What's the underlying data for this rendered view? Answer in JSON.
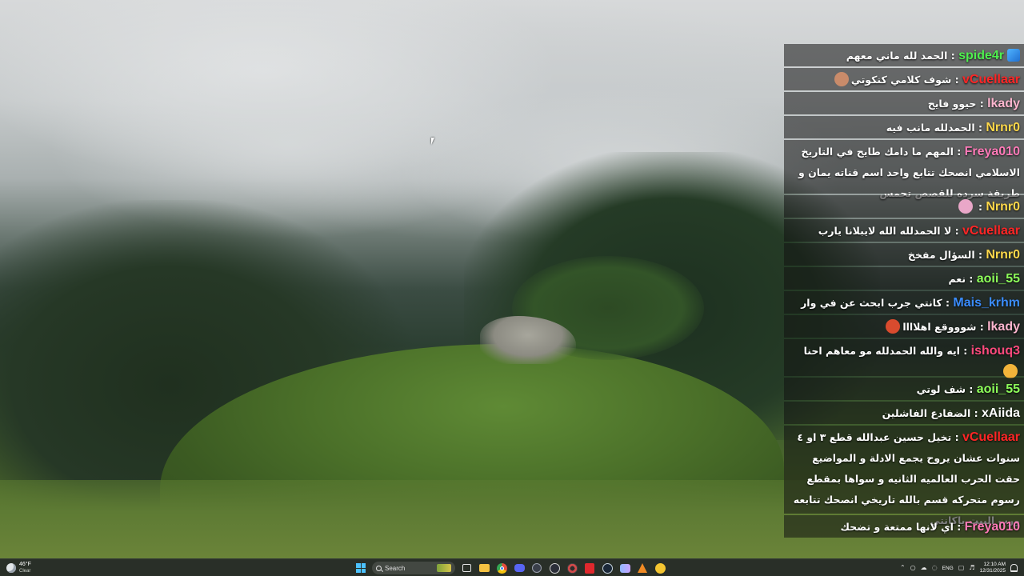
{
  "chat": {
    "messages": [
      {
        "user": "spide4r",
        "user_color": "#4ff04f",
        "sep": " : ",
        "text": "الحمد لله ماني معهم",
        "badge": "cube-badge"
      },
      {
        "user": "vCuellaar",
        "user_color": "#ff2626",
        "sep": " : ",
        "text": "شوف كلامي كنكوتي",
        "emote": "face-emote"
      },
      {
        "user": "lkady",
        "user_color": "#ffb6cf",
        "sep": " : ",
        "text": "حيوو فايح"
      },
      {
        "user": "Nrnr0",
        "user_color": "#ffd84a",
        "sep": " : ",
        "text": "الحمدلله مانب فيه"
      },
      {
        "user": "Freya010",
        "user_color": "#ff7ab8",
        "sep": " : ",
        "text": "المهم ما دامك طايح في التاريخ الاسلامي انصحك تتابع واحد اسم قناته يمان و طريقة سرده للقصص تحمس"
      },
      {
        "user": "Nrnr0",
        "user_color": "#ffd84a",
        "sep": " : ",
        "text": "",
        "emote": "brain-emote"
      },
      {
        "user": "vCuellaar",
        "user_color": "#ff2626",
        "sep": " : ",
        "text": "لا الحمدلله الله لايبلانا يارب"
      },
      {
        "user": "Nrnr0",
        "user_color": "#ffd84a",
        "sep": " : ",
        "text": "السؤال مفخخ"
      },
      {
        "user": "aoii_55",
        "user_color": "#8dff5a",
        "sep": " : ",
        "text": "نعم"
      },
      {
        "user": "Mais_krhm",
        "user_color": "#3a8cff",
        "sep": " : ",
        "text": "كانتي جرب ابحث عن في وار"
      },
      {
        "user": "lkady",
        "user_color": "#ffb6cf",
        "sep": " : ",
        "text": "شوووقع اهلاااا",
        "emote": "fire-emote"
      },
      {
        "user": "ishouq3",
        "user_color": "#ff4a7d",
        "sep": " : ",
        "text": "ايه والله الحمدلله مو معاهم احنا",
        "emote": "smile-emote"
      },
      {
        "user": "aoii_55",
        "user_color": "#8dff5a",
        "sep": " : ",
        "text": "شف لوتي"
      },
      {
        "user": "xAiida",
        "user_color": "#ffffff",
        "sep": " : ",
        "text": "الضفادع الفاشلين"
      },
      {
        "user": "vCuellaar",
        "user_color": "#ff2626",
        "sep": " : ",
        "text": "تخيل حسين عبدالله قطع ٣ او ٤ سنوات عشان يروح يجمع الادلة و المواضيع حقت الحرب العالميه الثانيه و سواها بمقطع رسوم متحركه قسم بالله تاريخي انصحك تتابعه ورب البيت ياكانتي"
      },
      {
        "user": "Freya010",
        "user_color": "#ff7ab8",
        "sep": " : ",
        "text": "اي لانها ممتعة و تضحك"
      }
    ]
  },
  "taskbar": {
    "weather": {
      "temp": "46°F",
      "condition": "Clear",
      "icon": "moon-cloud-icon"
    },
    "search_placeholder": "Search",
    "pinned_icons": [
      "windows-start-icon",
      "task-view-icon",
      "file-explorer-icon",
      "chrome-icon",
      "discord-icon",
      "app-icon",
      "obs-icon",
      "settings-icon",
      "red-app-icon",
      "steam-icon",
      "game-icon",
      "adobe-icon",
      "yellow-app-icon"
    ],
    "tray": {
      "language": "ENG",
      "time": "12:10 AM",
      "date": "12/31/2025"
    }
  },
  "colors": {
    "chat_background": "rgba(18,18,18,0.55)",
    "taskbar_background": "#20241e",
    "windows_accent": "#4cc2ff"
  }
}
